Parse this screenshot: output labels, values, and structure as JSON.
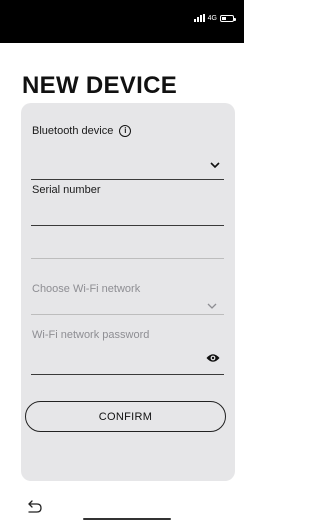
{
  "status_bar": {
    "network": "4G"
  },
  "page": {
    "title": "NEW DEVICE"
  },
  "form": {
    "bluetooth_label": "Bluetooth device",
    "bluetooth_value": "",
    "serial_label": "Serial number",
    "serial_value": "",
    "wifi_network_placeholder": "Choose Wi-Fi network",
    "wifi_password_placeholder": "Wi-Fi network password",
    "confirm_label": "CONFIRM"
  },
  "icons": {
    "info": "info-icon",
    "chevron": "chevron-down-icon",
    "eye": "eye-icon",
    "back": "back-arrow-icon"
  },
  "colors": {
    "status_bar": "#000000",
    "card_background": "#e6e6e8",
    "text": "#111111",
    "disabled_text": "#8e8e93"
  }
}
